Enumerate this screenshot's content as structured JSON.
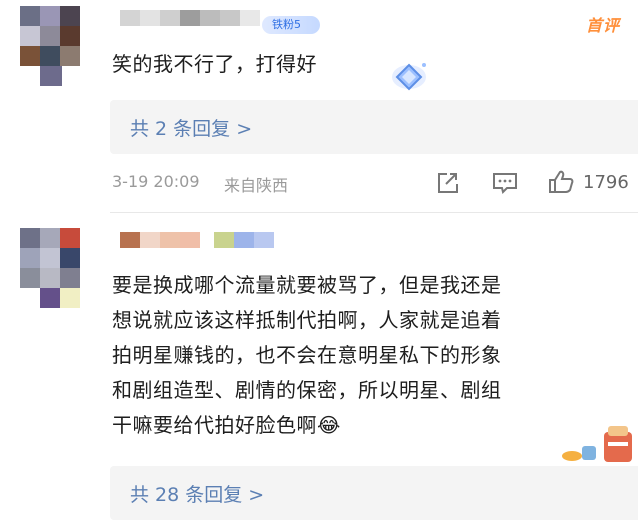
{
  "comments": [
    {
      "first_comment_tag": "首评",
      "fan_badge": "铁粉5",
      "text_lines": [
        "笑的我不行了，打得好"
      ],
      "reply_link": "共 2 条回复 >",
      "date": "3-19 20:09",
      "location": "来自陕西",
      "like_count": "1796",
      "icons": [
        "share-icon",
        "comment-icon",
        "like-icon",
        "diamond-sticker-icon"
      ]
    },
    {
      "text_lines": [
        "要是换成哪个流量就要被骂了，但是我还是",
        "想说就应该这样抵制代拍啊，人家就是追着",
        "拍明星赚钱的，也不会在意明星私下的形象",
        "和剧组造型、剧情的保密，所以明星、剧组",
        "干嘛要给代拍好脸色啊😂"
      ],
      "reply_link": "共 28 条回复 >",
      "icons": [
        "laughing-emoji-icon",
        "breakfast-sticker-icon"
      ]
    }
  ],
  "colors": {
    "link": "#5b7fb3",
    "first_comment": "#ff8f3a",
    "meta": "#9a9a9a",
    "reply_bg": "#f4f4f4"
  }
}
